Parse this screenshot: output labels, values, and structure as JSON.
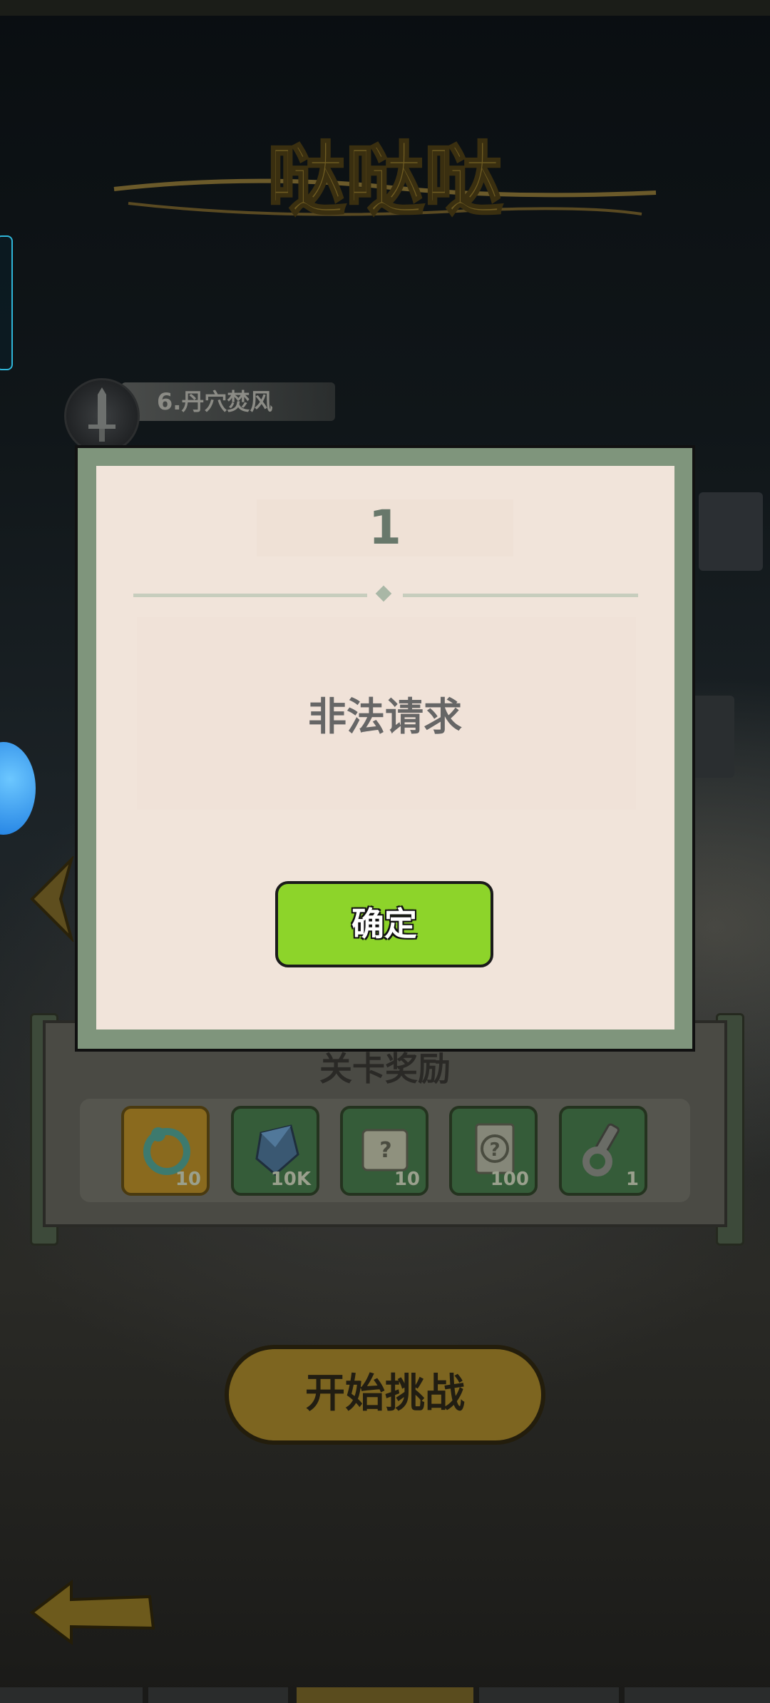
{
  "header": {
    "title_art_text": "哒哒哒"
  },
  "stage": {
    "label": "6.丹穴焚风"
  },
  "rewards": {
    "title": "关卡奖励",
    "items": [
      {
        "icon": "dragon-token-icon",
        "qty": "10"
      },
      {
        "icon": "crystal-icon",
        "qty": "10K"
      },
      {
        "icon": "scroll-map-icon",
        "qty": "10"
      },
      {
        "icon": "mystery-scroll-icon",
        "qty": "100"
      },
      {
        "icon": "wrench-key-icon",
        "qty": "1"
      }
    ]
  },
  "actions": {
    "start_label": "开始挑战"
  },
  "dialog": {
    "title": "1",
    "message": "非法请求",
    "confirm_label": "确定"
  },
  "colors": {
    "dialog_frame": "#7f957c",
    "dialog_bg": "#f1e4da",
    "confirm_button": "#8dd42a"
  }
}
